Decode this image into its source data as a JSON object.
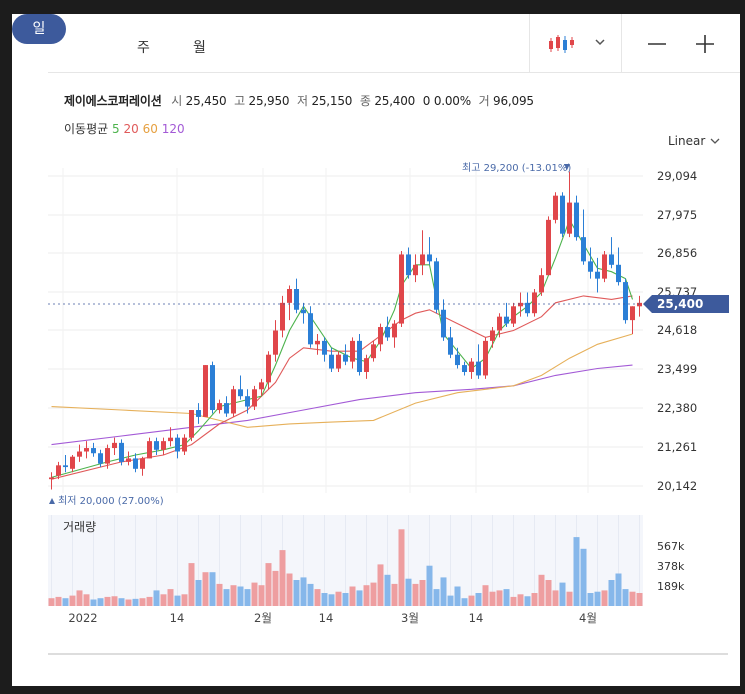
{
  "tabs": {
    "day": "일",
    "week": "주",
    "month": "월"
  },
  "toolbar": {
    "chart_type_icon": "candlestick-icon",
    "zoom_out": "—",
    "zoom_in": "+"
  },
  "summary": {
    "name": "제이에스코퍼레이션",
    "open_label": "시",
    "open": "25,450",
    "high_label": "고",
    "high": "25,950",
    "low_label": "저",
    "low": "25,150",
    "close_label": "종",
    "close": "25,400",
    "change": "0",
    "change_pct": "0.00%",
    "volume_label": "거",
    "volume": "96,095"
  },
  "ma_legend": {
    "label": "이동평균",
    "p5": "5",
    "p20": "20",
    "p60": "60",
    "p120": "120"
  },
  "scale": {
    "label": "Linear"
  },
  "colors": {
    "up": "#e0464a",
    "down": "#2b7fd6",
    "vol_up": "#ee9ea0",
    "vol_down": "#86b7ea",
    "ma5": "#4db34d",
    "ma20": "#e05a5a",
    "ma60": "#e6b05a",
    "ma120": "#a35ad6",
    "accent": "#3d5a9c"
  },
  "chart_data": {
    "type": "candlestick",
    "y_ticks": [
      "29,094",
      "27,975",
      "26,856",
      "25,737",
      "24,618",
      "23,499",
      "22,380",
      "21,261",
      "20,142"
    ],
    "x_ticks": [
      "2022",
      "14",
      "2월",
      "14",
      "3월",
      "14",
      "4월"
    ],
    "current_price": "25,400",
    "max_label": "최고 29,200 (-13.01%)",
    "min_label": "최저 20,000 (27.00%)",
    "volume_label": "거래량",
    "volume_ticks": [
      "567k",
      "378k",
      "189k"
    ],
    "ylim": [
      19900,
      29300
    ],
    "volume_max": 700,
    "candles": [
      [
        20300,
        20500,
        20000,
        20350,
        60
      ],
      [
        20400,
        20800,
        20300,
        20700,
        70
      ],
      [
        20700,
        21000,
        20500,
        20650,
        60
      ],
      [
        20600,
        21000,
        20500,
        20950,
        80
      ],
      [
        20950,
        21300,
        20800,
        21100,
        120
      ],
      [
        21100,
        21400,
        20900,
        21200,
        90
      ],
      [
        21200,
        21350,
        20950,
        21050,
        50
      ],
      [
        21050,
        21150,
        20650,
        20750,
        60
      ],
      [
        20750,
        21300,
        20600,
        21200,
        70
      ],
      [
        21200,
        21500,
        21000,
        21350,
        75
      ],
      [
        21350,
        21450,
        20700,
        20800,
        60
      ],
      [
        20800,
        21100,
        20700,
        20900,
        50
      ],
      [
        20900,
        21050,
        20500,
        20600,
        55
      ],
      [
        20600,
        20950,
        20400,
        20900,
        60
      ],
      [
        20900,
        21500,
        20900,
        21400,
        70
      ],
      [
        21400,
        21500,
        21000,
        21150,
        120
      ],
      [
        21150,
        21500,
        21000,
        21400,
        90
      ],
      [
        21400,
        21800,
        21250,
        21500,
        130
      ],
      [
        21500,
        21600,
        20900,
        21100,
        80
      ],
      [
        21100,
        21600,
        21000,
        21500,
        90
      ],
      [
        21500,
        22300,
        21400,
        22300,
        330
      ],
      [
        22300,
        22500,
        21900,
        22100,
        200
      ],
      [
        22100,
        23600,
        22100,
        23600,
        260
      ],
      [
        23600,
        23700,
        22200,
        22300,
        260
      ],
      [
        22300,
        22600,
        22200,
        22500,
        170
      ],
      [
        22500,
        22700,
        22100,
        22200,
        130
      ],
      [
        22200,
        23000,
        22100,
        22900,
        160
      ],
      [
        22900,
        23300,
        22600,
        22700,
        150
      ],
      [
        22700,
        22900,
        22200,
        22400,
        130
      ],
      [
        22400,
        23000,
        22300,
        22900,
        180
      ],
      [
        22900,
        23200,
        22700,
        23100,
        160
      ],
      [
        23100,
        24000,
        22900,
        23900,
        330
      ],
      [
        23900,
        24900,
        23700,
        24600,
        270
      ],
      [
        24600,
        25600,
        24400,
        25400,
        430
      ],
      [
        25400,
        25900,
        24900,
        25800,
        250
      ],
      [
        25800,
        26100,
        25100,
        25200,
        200
      ],
      [
        25200,
        25400,
        24800,
        25100,
        220
      ],
      [
        25100,
        25300,
        24100,
        24200,
        170
      ],
      [
        24200,
        24500,
        23900,
        24300,
        130
      ],
      [
        24300,
        24400,
        23700,
        23900,
        100
      ],
      [
        23900,
        24100,
        23400,
        23500,
        90
      ],
      [
        23500,
        24000,
        23400,
        23900,
        110
      ],
      [
        23900,
        24200,
        23600,
        23700,
        100
      ],
      [
        23700,
        24400,
        23500,
        24300,
        150
      ],
      [
        24300,
        24500,
        23300,
        23400,
        120
      ],
      [
        23400,
        23900,
        23200,
        23800,
        160
      ],
      [
        23800,
        24300,
        23700,
        24200,
        180
      ],
      [
        24200,
        24800,
        24000,
        24700,
        320
      ],
      [
        24700,
        25000,
        24300,
        24400,
        240
      ],
      [
        24400,
        24900,
        24100,
        24800,
        170
      ],
      [
        24800,
        26900,
        24700,
        26800,
        590
      ],
      [
        26800,
        27000,
        26100,
        26200,
        210
      ],
      [
        26200,
        26800,
        26000,
        26500,
        170
      ],
      [
        26500,
        27500,
        26200,
        26800,
        200
      ],
      [
        26800,
        27300,
        26500,
        26600,
        310
      ],
      [
        26600,
        26700,
        25100,
        25200,
        130
      ],
      [
        25200,
        25500,
        24300,
        24400,
        220
      ],
      [
        24400,
        24700,
        23800,
        23900,
        80
      ],
      [
        23900,
        24100,
        23500,
        23600,
        150
      ],
      [
        23600,
        23700,
        23300,
        23400,
        60
      ],
      [
        23400,
        23800,
        23200,
        23700,
        80
      ],
      [
        23700,
        24200,
        23200,
        23300,
        100
      ],
      [
        23300,
        24400,
        23200,
        24300,
        160
      ],
      [
        24300,
        24700,
        24100,
        24600,
        110
      ],
      [
        24600,
        25100,
        24400,
        25000,
        120
      ],
      [
        25000,
        25400,
        24700,
        24800,
        130
      ],
      [
        24800,
        25400,
        24700,
        25300,
        70
      ],
      [
        25300,
        25700,
        25000,
        25400,
        90
      ],
      [
        25400,
        25700,
        25000,
        25100,
        75
      ],
      [
        25100,
        25800,
        25000,
        25700,
        100
      ],
      [
        25700,
        26400,
        25600,
        26200,
        240
      ],
      [
        26200,
        27900,
        26200,
        27800,
        200
      ],
      [
        27800,
        28600,
        27700,
        28500,
        120
      ],
      [
        28500,
        28600,
        27300,
        27400,
        180
      ],
      [
        27400,
        29200,
        27300,
        28300,
        110
      ],
      [
        28300,
        28500,
        27200,
        27300,
        530
      ],
      [
        27300,
        28100,
        26500,
        26600,
        440
      ],
      [
        26600,
        27000,
        26100,
        26300,
        100
      ],
      [
        26300,
        26700,
        25700,
        26100,
        110
      ],
      [
        26100,
        26900,
        26000,
        26800,
        120
      ],
      [
        26800,
        27300,
        26400,
        26500,
        200
      ],
      [
        26500,
        27000,
        25900,
        26000,
        250
      ],
      [
        26000,
        26100,
        24800,
        24900,
        130
      ],
      [
        24900,
        25300,
        24500,
        25300,
        110
      ],
      [
        25300,
        25600,
        25000,
        25400,
        100
      ]
    ],
    "ma5": [
      [
        0,
        20350
      ],
      [
        8,
        20800
      ],
      [
        12,
        21000
      ],
      [
        16,
        21150
      ],
      [
        19,
        21300
      ],
      [
        21,
        21700
      ],
      [
        24,
        22400
      ],
      [
        28,
        22600
      ],
      [
        30,
        22700
      ],
      [
        32,
        23600
      ],
      [
        34,
        24600
      ],
      [
        36,
        25300
      ],
      [
        38,
        24700
      ],
      [
        40,
        24100
      ],
      [
        43,
        23800
      ],
      [
        45,
        23700
      ],
      [
        47,
        24300
      ],
      [
        49,
        25200
      ],
      [
        50,
        25900
      ],
      [
        52,
        26500
      ],
      [
        54,
        26500
      ],
      [
        56,
        24500
      ],
      [
        58,
        24000
      ],
      [
        60,
        23500
      ],
      [
        62,
        23800
      ],
      [
        64,
        24600
      ],
      [
        66,
        25000
      ],
      [
        68,
        25300
      ],
      [
        70,
        25700
      ],
      [
        72,
        26700
      ],
      [
        74,
        27800
      ],
      [
        76,
        27100
      ],
      [
        78,
        26400
      ],
      [
        80,
        26300
      ],
      [
        82,
        26100
      ],
      [
        83,
        25500
      ]
    ],
    "ma20": [
      [
        0,
        20300
      ],
      [
        10,
        20800
      ],
      [
        16,
        21000
      ],
      [
        20,
        21300
      ],
      [
        24,
        21900
      ],
      [
        28,
        22300
      ],
      [
        30,
        22700
      ],
      [
        32,
        23100
      ],
      [
        34,
        23800
      ],
      [
        36,
        24100
      ],
      [
        40,
        24000
      ],
      [
        44,
        24000
      ],
      [
        48,
        24600
      ],
      [
        50,
        24900
      ],
      [
        52,
        25100
      ],
      [
        54,
        25200
      ],
      [
        58,
        24800
      ],
      [
        62,
        24400
      ],
      [
        66,
        24600
      ],
      [
        70,
        25000
      ],
      [
        72,
        25400
      ],
      [
        76,
        25600
      ],
      [
        80,
        25500
      ],
      [
        83,
        25600
      ]
    ],
    "ma60": [
      [
        0,
        22400
      ],
      [
        10,
        22300
      ],
      [
        20,
        22200
      ],
      [
        28,
        21800
      ],
      [
        34,
        21900
      ],
      [
        40,
        21950
      ],
      [
        46,
        22000
      ],
      [
        52,
        22500
      ],
      [
        58,
        22800
      ],
      [
        62,
        22900
      ],
      [
        66,
        23000
      ],
      [
        70,
        23300
      ],
      [
        74,
        23800
      ],
      [
        78,
        24200
      ],
      [
        83,
        24500
      ]
    ],
    "ma120": [
      [
        0,
        21300
      ],
      [
        10,
        21550
      ],
      [
        20,
        21800
      ],
      [
        28,
        22000
      ],
      [
        36,
        22300
      ],
      [
        44,
        22600
      ],
      [
        52,
        22800
      ],
      [
        60,
        22900
      ],
      [
        66,
        23000
      ],
      [
        72,
        23300
      ],
      [
        78,
        23500
      ],
      [
        83,
        23600
      ]
    ]
  }
}
